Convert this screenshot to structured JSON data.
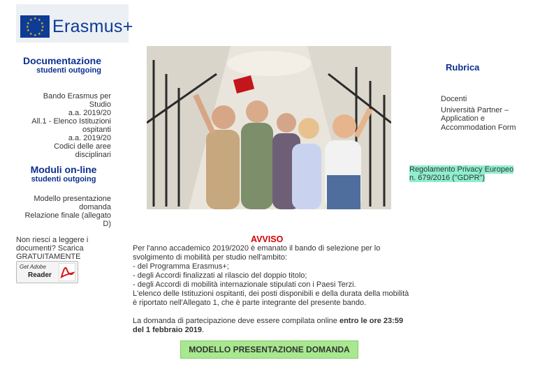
{
  "logo": {
    "text": "Erasmus+",
    "icon": "eu-flag-icon"
  },
  "left": {
    "documentazione_title": "Documentazione",
    "documentazione_subtitle": "studenti outgoing",
    "links": [
      "Bando Erasmus per Studio",
      "a.a. 2019/20",
      "All.1 - Elenco Istituzioni ospitanti",
      "a.a. 2019/20",
      "Codici delle aree disciplinari"
    ],
    "moduli_title": "Moduli on-line",
    "moduli_subtitle": "studenti outgoing",
    "moduli_links": [
      "Modello presentazione domanda",
      "Relazione finale (allegato D)"
    ],
    "reader_note": "Non riesci a leggere i documenti? Scarica GRATUITAMENTE",
    "reader_badge_get": "Get Adobe",
    "reader_badge_name": "Reader",
    "reader_badge_icon": "adobe-reader-icon"
  },
  "right": {
    "rubrica": "Rubrica",
    "links": [
      "Docenti",
      "Università Partner – Application e Accommodation Form"
    ],
    "privacy": "Regolamento Privacy Europeo n. 679/2016 (\"GDPR\")"
  },
  "notice": {
    "title": "AVVISO",
    "paragraph1": "Per l'anno accademico 2019/2020 è emanato il bando di selezione per lo svolgimento di mobilità per studio nell'ambito:",
    "bullets": [
      "- del Programma Erasmus+;",
      "- degli Accordi finalizzati al rilascio del doppio titolo;",
      "- degli Accordi di mobilità internazionale stipulati con i Paesi Terzi."
    ],
    "paragraph2": "L'elenco delle Istituzioni ospitanti, dei posti disponibili e della durata della mobilità è riportato nell'Allegato 1, che è parte integrante del presente bando.",
    "deadline_prefix": "La domanda di partecipazione deve essere compilata online ",
    "deadline_bold": "entro le ore 23:59 del 1 febbraio 2019",
    "deadline_suffix": ".",
    "button": "MODELLO PRESENTAZIONE DOMANDA"
  },
  "colors": {
    "brand_blue": "#0d2f8f",
    "notice_red": "#d20000",
    "button_green": "#a8e98f",
    "privacy_highlight": "#8fefcf"
  }
}
